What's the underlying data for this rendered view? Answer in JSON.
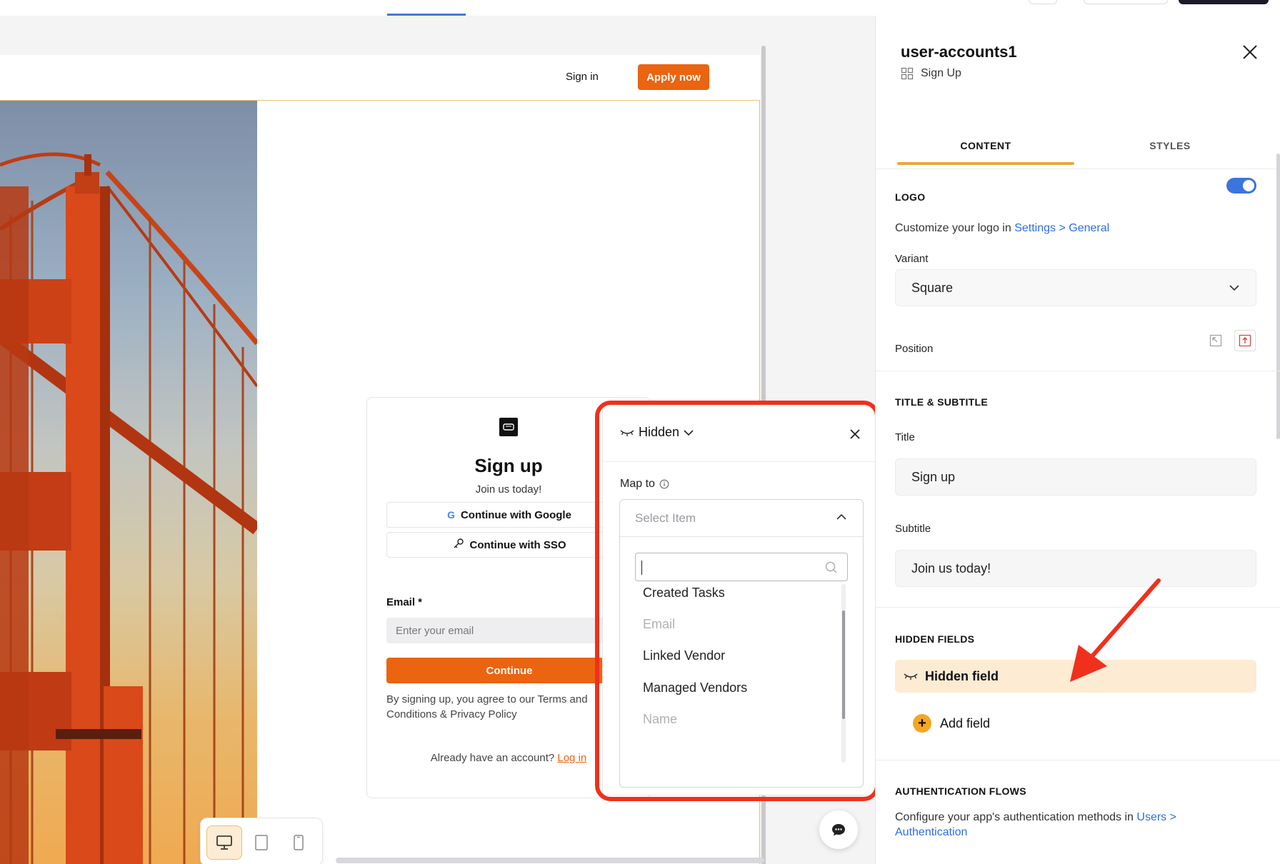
{
  "site": {
    "signin_label": "Sign in",
    "apply_label": "Apply now"
  },
  "card": {
    "title": "Sign up",
    "subtitle": "Join us today!",
    "google_label": "Continue with Google",
    "sso_label": "Continue with SSO",
    "email_label": "Email *",
    "email_placeholder": "Enter your email",
    "continue_label": "Continue",
    "terms_text": "By signing up, you agree to our Terms and Conditions & Privacy Policy",
    "login_prompt": "Already have an account?",
    "login_link": "Log in"
  },
  "popup": {
    "visibility_label": "Hidden",
    "map_to_label": "Map to",
    "select_placeholder": "Select Item",
    "search_value": "",
    "options": [
      {
        "label": "Created Tasks",
        "disabled": false
      },
      {
        "label": "Email",
        "disabled": true
      },
      {
        "label": "Linked Vendor",
        "disabled": false
      },
      {
        "label": "Managed Vendors",
        "disabled": false
      },
      {
        "label": "Name",
        "disabled": true
      }
    ]
  },
  "panel": {
    "component_name": "user-accounts1",
    "component_type": "Sign Up",
    "tabs": [
      {
        "label": "CONTENT",
        "active": true
      },
      {
        "label": "STYLES",
        "active": false
      }
    ],
    "logo": {
      "heading": "LOGO",
      "enabled": true,
      "description_prefix": "Customize your logo in",
      "description_link": "Settings > General",
      "variant_label": "Variant",
      "variant_value": "Square",
      "position_label": "Position"
    },
    "title_subtitle": {
      "heading": "TITLE & SUBTITLE",
      "title_label": "Title",
      "title_value": "Sign up",
      "subtitle_label": "Subtitle",
      "subtitle_value": "Join us today!"
    },
    "hidden_fields": {
      "heading": "HIDDEN FIELDS",
      "items": [
        "Hidden field"
      ],
      "add_label": "Add field"
    },
    "auth_flows": {
      "heading": "AUTHENTICATION FLOWS",
      "description_prefix": "Configure your app's authentication methods in",
      "description_link": "Users > Authentication"
    }
  },
  "colors": {
    "brand_orange": "#eb640f",
    "accent_blue": "#3b74dd",
    "highlight_red": "#f0301c",
    "hidden_row_bg": "#fdebd4"
  }
}
